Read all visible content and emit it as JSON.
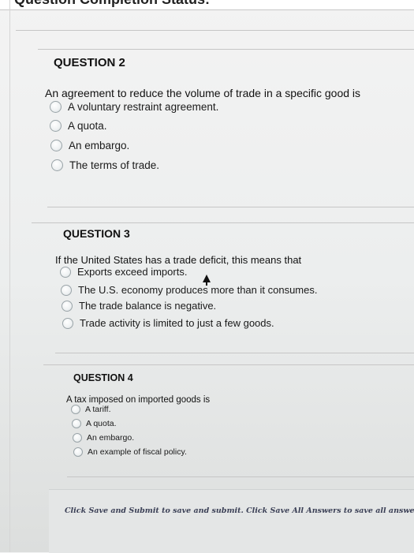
{
  "header": {
    "title": "Question Completion Status:"
  },
  "questions": [
    {
      "title": "QUESTION 2",
      "prompt": "An agreement to reduce the volume of trade in a specific good is",
      "options": [
        "A voluntary restraint agreement.",
        "A quota.",
        "An embargo.",
        "The terms of trade."
      ]
    },
    {
      "title": "QUESTION 3",
      "prompt": "If the United States has a trade deficit, this means that",
      "options": [
        "Exports exceed imports.",
        "The U.S. economy produces more than it consumes.",
        "The trade balance is negative.",
        "Trade activity is limited to just a few goods."
      ]
    },
    {
      "title": "QUESTION 4",
      "prompt": "A tax imposed on imported goods is",
      "options": [
        "A tariff.",
        "A quota.",
        "An embargo.",
        "An example of fiscal policy."
      ]
    }
  ],
  "footer": {
    "instructions": "Click Save and Submit to save and submit. Click Save All Answers to save all answers."
  }
}
